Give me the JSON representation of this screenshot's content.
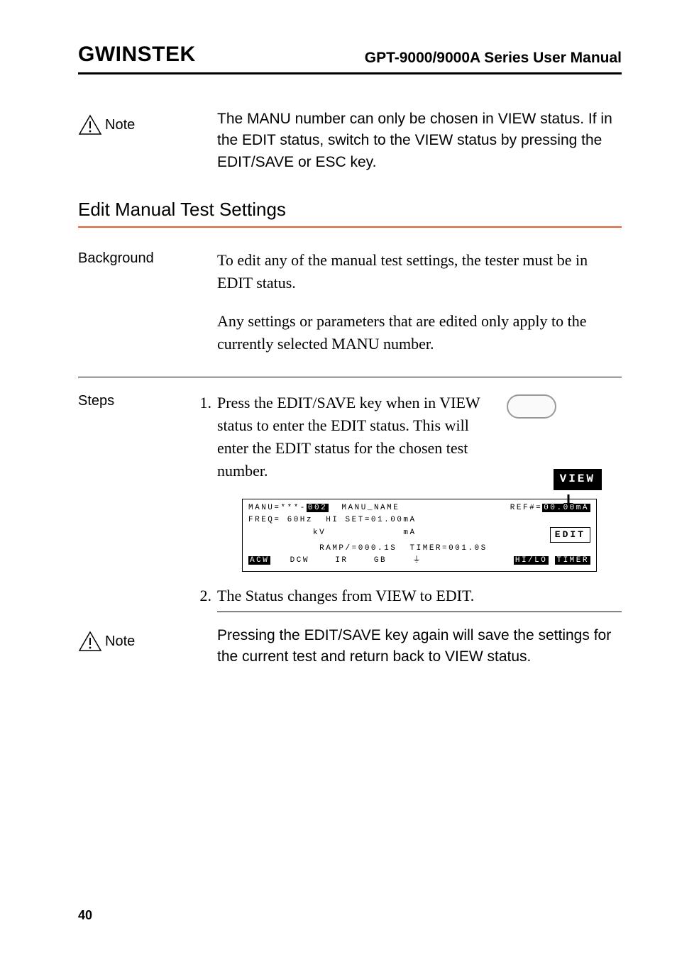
{
  "header": {
    "logo": "GWINSTEK",
    "title": "GPT-9000/9000A Series User Manual"
  },
  "note1": {
    "label": "Note",
    "text": "The MANU number can only be chosen in VIEW status. If in the EDIT status, switch to the VIEW status by pressing the EDIT/SAVE or ESC key."
  },
  "section_heading": "Edit Manual Test Settings",
  "background": {
    "label": "Background",
    "para1": "To edit any of the manual test settings, the tester must be in EDIT status.",
    "para2": "Any settings or parameters that are edited only apply to the currently selected MANU number."
  },
  "steps": {
    "label": "Steps",
    "items": [
      {
        "num": "1.",
        "text": "Press the EDIT/SAVE key when in VIEW status to enter the EDIT status. This will enter the EDIT status for the chosen test number."
      },
      {
        "num": "2.",
        "text": "The Status changes from VIEW to EDIT."
      }
    ]
  },
  "lcd": {
    "view_label": "VIEW",
    "line1_left": "MANU=***-",
    "line1_manu_num": "002",
    "line1_mid": "  MANU_NAME",
    "line1_right_pre": "REF#=",
    "line1_right_val": "00.00mA",
    "line2": "FREQ= 60Hz  HI SET=01.00mA",
    "line3_left": "          kV            mA",
    "line3_edit": "EDIT",
    "line4_left": "           RAMP/=000.1S  TIMER=001.0S",
    "line5_acw": "ACW",
    "line5_mid": "   DCW    IR    GB    ",
    "line5_hilo": "HI/LO",
    "line5_timer": "TIMER"
  },
  "note2": {
    "label": "Note",
    "text": "Pressing the EDIT/SAVE key again will save the settings for the current test and return back to VIEW status."
  },
  "page_number": "40"
}
